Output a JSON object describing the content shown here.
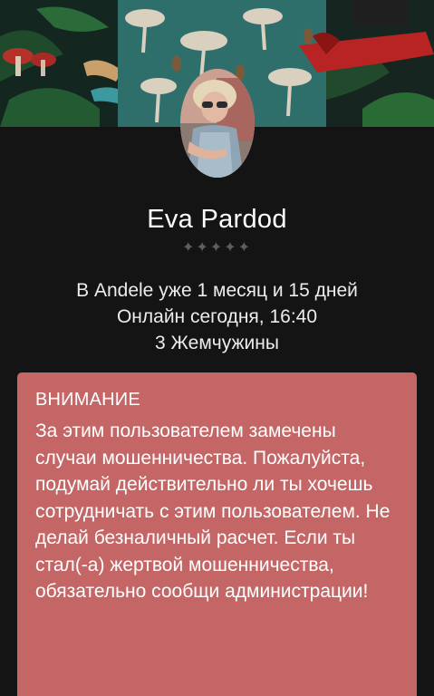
{
  "profile": {
    "name": "Eva Pardod",
    "rating_stars": "✦✦✦✦✦",
    "membership": "В Andele уже 1 месяц и 15 дней",
    "online_status": "Онлайн сегодня, 16:40",
    "pearls": "3 Жемчужины"
  },
  "warning": {
    "title": "ВНИМАНИЕ",
    "text": "За этим пользователем замечены случаи мошенничества. Пожалуйста, подумай действительно ли ты хочешь сотрудничать с этим пользователем. Не делай безналичный расчет. Если ты стал(-а) жертвой мошенничества, обязательно сообщи администрации!"
  },
  "colors": {
    "background": "#141414",
    "warning_background": "#c56666",
    "star_color": "#5e5e5e"
  }
}
